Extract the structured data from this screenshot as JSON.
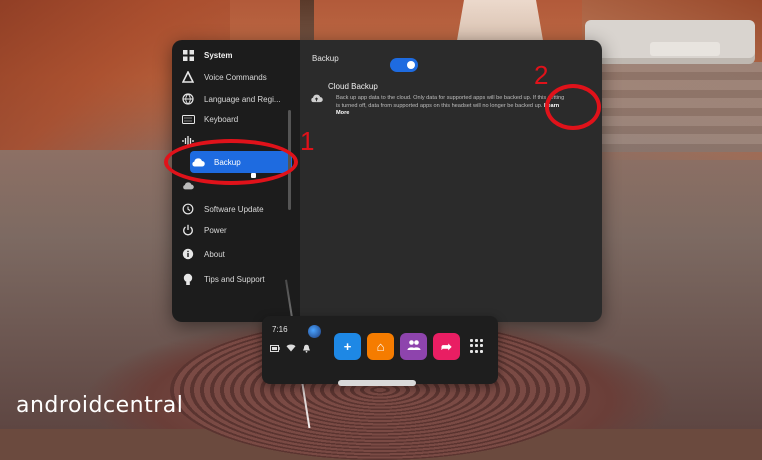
{
  "window": {
    "panel_title": "Backup"
  },
  "sidebar": {
    "items": [
      {
        "label": "System",
        "icon": "grid-icon"
      },
      {
        "label": "Voice Commands",
        "icon": "voice-icon"
      },
      {
        "label": "Language and Regi...",
        "icon": "globe-icon"
      },
      {
        "label": "Keyboard",
        "icon": "keyboard-icon"
      },
      {
        "label": "",
        "icon": "audio-icon"
      },
      {
        "label": "Backup",
        "icon": "cloud-icon"
      },
      {
        "label": "",
        "icon": "cloud-icon"
      },
      {
        "label": "Software Update",
        "icon": "update-icon"
      },
      {
        "label": "Power",
        "icon": "power-icon"
      },
      {
        "label": "About",
        "icon": "info-icon"
      },
      {
        "label": "Tips and Support",
        "icon": "bulb-icon"
      }
    ],
    "active_item": "Backup"
  },
  "cloud_backup": {
    "title": "Cloud Backup",
    "description": "Back up app data to the cloud. Only data for supported apps will be backed up. If this setting is turned off, data from supported apps on this headset will no longer be backed up.",
    "learn_more": "Learn More",
    "enabled": true
  },
  "annotations": {
    "label_1": "1",
    "label_2": "2",
    "color": "#e0121a"
  },
  "taskbar": {
    "time": "7:16",
    "apps": [
      {
        "name": "explore",
        "icon": "compass-icon",
        "color": "#1e88e5",
        "glyph": "+"
      },
      {
        "name": "store",
        "icon": "store-bag-icon",
        "color": "#f57c00",
        "glyph": "⌂"
      },
      {
        "name": "people",
        "icon": "people-icon",
        "color": "#8e44ad",
        "glyph": "👥"
      },
      {
        "name": "share",
        "icon": "share-arrow-icon",
        "color": "#e91e63",
        "glyph": "➦"
      }
    ]
  },
  "watermark": "androidcentral",
  "colors": {
    "accent": "#1e6be0",
    "panel_bg": "#2b2b2b",
    "sidebar_bg": "#1c1c1c"
  }
}
